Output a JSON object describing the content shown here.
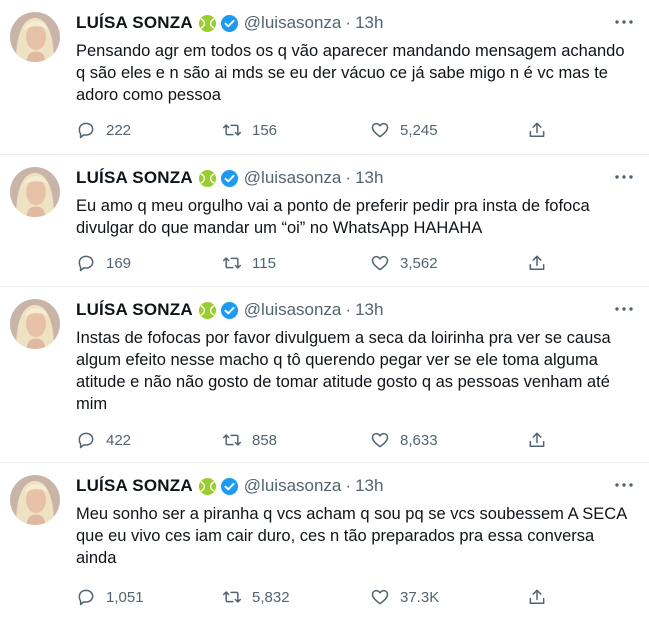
{
  "tweets": [
    {
      "name": "LUÍSA SONZA",
      "handle": "@luisasonza",
      "separator": "·",
      "time": "13h",
      "text": "Pensando agr em todos os q vão aparecer mandando mensagem achando q são eles e n são ai mds se eu der vácuo ce já sabe migo n é vc mas te adoro como pessoa",
      "replies": "222",
      "retweets": "156",
      "likes": "5,245"
    },
    {
      "name": "LUÍSA SONZA",
      "handle": "@luisasonza",
      "separator": "·",
      "time": "13h",
      "text": "Eu amo q meu orgulho vai a ponto de preferir pedir pra insta de fofoca divulgar do que mandar um “oi” no WhatsApp HAHAHA",
      "replies": "169",
      "retweets": "115",
      "likes": "3,562"
    },
    {
      "name": "LUÍSA SONZA",
      "handle": "@luisasonza",
      "separator": "·",
      "time": "13h",
      "text": "Instas de fofocas por favor divulguem a seca da loirinha pra ver se causa algum efeito nesse macho q tô querendo pegar ver se ele toma alguma atitude e não não gosto de tomar atitude gosto q as pessoas venham até mim",
      "replies": "422",
      "retweets": "858",
      "likes": "8,633"
    },
    {
      "name": "LUÍSA SONZA",
      "handle": "@luisasonza",
      "separator": "·",
      "time": "13h",
      "text": "Meu sonho ser a piranha q vcs acham q sou pq se vcs soubessem A SECA que eu vivo ces iam cair duro, ces n tão preparados pra essa conversa ainda",
      "replies": "1,051",
      "retweets": "5,832",
      "likes": "37.3K"
    }
  ],
  "icons": {
    "reply": "reply-icon",
    "retweet": "retweet-icon",
    "like": "like-icon",
    "share": "share-icon",
    "more": "more-icon",
    "verified": "verified-badge-icon",
    "name_emoji": "tennis-ball-icon"
  },
  "colors": {
    "text": "#0f1419",
    "secondary": "#536471",
    "verified": "#1d9bf0",
    "divider": "#e6ecf0",
    "tennis_ball": "#9acd32"
  }
}
